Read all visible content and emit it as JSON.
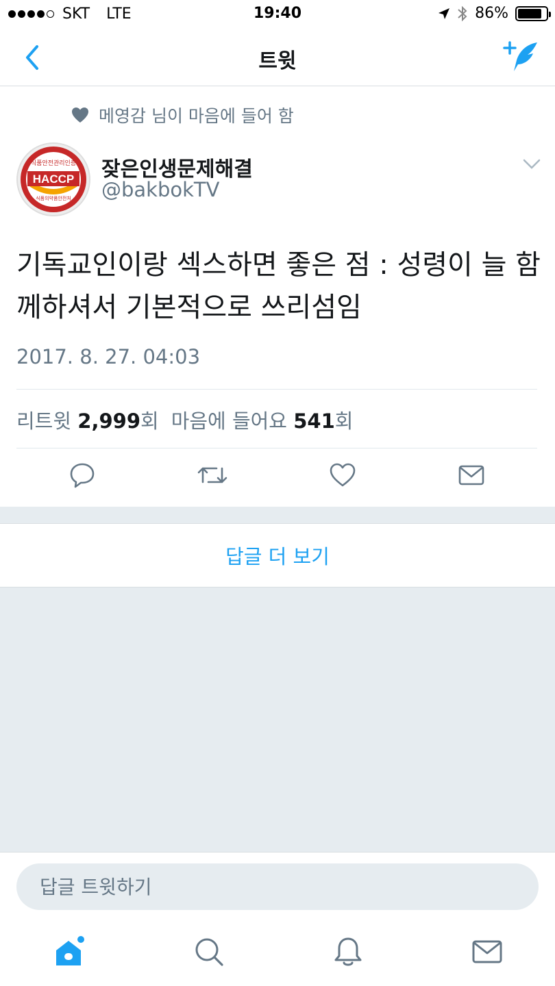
{
  "status_bar": {
    "carrier": "SKT",
    "network": "LTE",
    "time": "19:40",
    "battery_percent": "86%",
    "battery_level": 0.86,
    "icons": [
      "signal-dots",
      "location-arrow-icon",
      "bluetooth-icon",
      "battery-icon"
    ]
  },
  "nav": {
    "title": "트윗",
    "back_icon": "chevron-left-icon",
    "compose_icon": "compose-tweet-icon"
  },
  "tweet": {
    "social_context": "메영감 님이 마음에 들어 함",
    "author_name": "잦은인생문제해결",
    "author_handle": "@bakbokTV",
    "avatar_text": {
      "top": "식품안전관리인증",
      "center": "HACCP",
      "bottom": "식품의약품안전처"
    },
    "text": "기독교인이랑 섹스하면 좋은 점 : 성령이 늘 함께하셔서 기본적으로 쓰리섬임",
    "timestamp": "2017. 8. 27. 04:03",
    "stats": {
      "retweet_label": "리트윗",
      "retweet_count": "2,999",
      "retweet_unit": "회",
      "like_label": "마음에 들어요",
      "like_count": "541",
      "like_unit": "회"
    }
  },
  "more_replies": "답글 더 보기",
  "reply_bar": {
    "placeholder": "답글 트윗하기"
  },
  "tabbar": {
    "items": [
      "home-icon",
      "search-icon",
      "notifications-icon",
      "messages-icon"
    ]
  },
  "colors": {
    "accent": "#1da1f2",
    "secondary_text": "#657786",
    "background": "#e6ecf0"
  }
}
